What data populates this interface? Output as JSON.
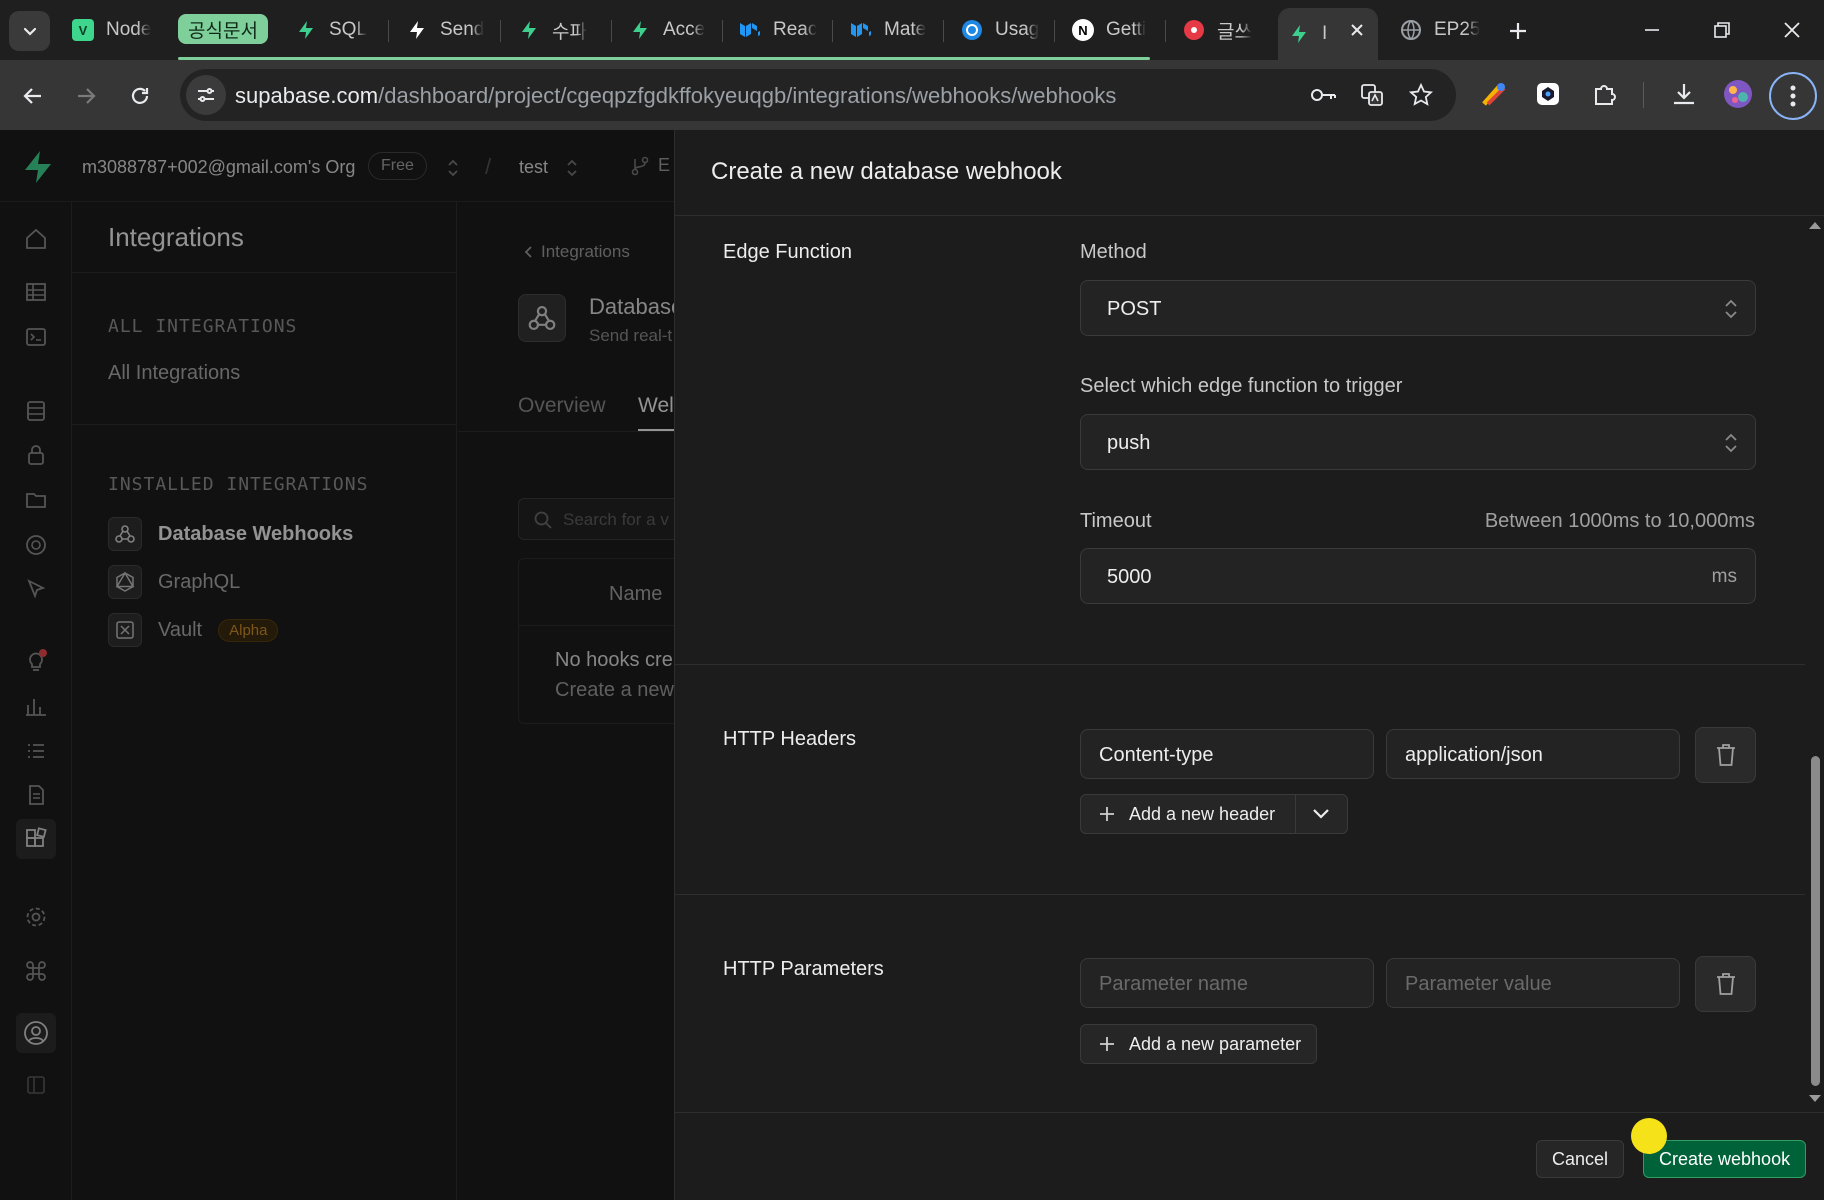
{
  "browser": {
    "tabs": [
      {
        "title": "Node",
        "icon": "v-icon",
        "color": "#3dd68c"
      },
      {
        "title": "SQL",
        "icon": "supabase-bolt-icon",
        "color": "#3ecf8e"
      },
      {
        "title": "Send",
        "icon": "bolt-icon",
        "color": "#ffffff"
      },
      {
        "title": "수파",
        "icon": "supabase-bolt-icon",
        "color": "#3ecf8e"
      },
      {
        "title": "Acce",
        "icon": "supabase-bolt-icon",
        "color": "#3ecf8e"
      },
      {
        "title": "Reac",
        "icon": "mui-icon",
        "color": "#2196f3"
      },
      {
        "title": "Mate",
        "icon": "mui-icon",
        "color": "#2196f3"
      },
      {
        "title": "Usag",
        "icon": "openai-icon",
        "color": "#1e88e5"
      },
      {
        "title": "Getti",
        "icon": "next-icon",
        "color": "#ffffff"
      },
      {
        "title": "글쓰",
        "icon": "red-circle-icon",
        "color": "#e53945"
      },
      {
        "title": "I",
        "icon": "supabase-bolt-icon",
        "color": "#3ecf8e"
      },
      {
        "title": "EP25",
        "icon": "globe-icon",
        "color": "#9aa0a6"
      }
    ],
    "tab_group_label": "공식문서",
    "url_host": "supabase.com",
    "url_path": "/dashboard/project/cgeqpzfgdkffokyeuqgb/integrations/webhooks/webhooks"
  },
  "app": {
    "org_name": "m3088787+002@gmail.com's Org",
    "plan": "Free",
    "project": "test",
    "branch_label": "E",
    "sidebar_title": "Integrations",
    "all_section": "ALL INTEGRATIONS",
    "all_link": "All Integrations",
    "installed_section": "INSTALLED INTEGRATIONS",
    "installed": [
      {
        "label": "Database Webhooks",
        "icon": "webhook-icon",
        "active": true
      },
      {
        "label": "GraphQL",
        "icon": "graphql-icon",
        "active": false
      },
      {
        "label": "Vault",
        "icon": "vault-icon",
        "active": false,
        "badge": "Alpha"
      }
    ],
    "breadcrumb": "Integrations",
    "integration_title": "Database",
    "integration_sub": "Send real-t",
    "tabs": [
      "Overview",
      "Wel"
    ],
    "search_placeholder": "Search for a v",
    "table_header": "Name",
    "empty_title": "No hooks cre",
    "empty_sub": "Create a new"
  },
  "sheet": {
    "title": "Create a new database webhook",
    "edge_section": "Edge Function",
    "method_label": "Method",
    "method_value": "POST",
    "function_label": "Select which edge function to trigger",
    "function_value": "push",
    "timeout_label": "Timeout",
    "timeout_hint": "Between 1000ms to 10,000ms",
    "timeout_value": "5000",
    "timeout_unit": "ms",
    "headers_section": "HTTP Headers",
    "header_name": "Content-type",
    "header_value": "application/json",
    "add_header": "Add a new header",
    "params_section": "HTTP Parameters",
    "param_name_placeholder": "Parameter name",
    "param_value_placeholder": "Parameter value",
    "add_param": "Add a new parameter",
    "cancel": "Cancel",
    "create": "Create webhook"
  },
  "colors": {
    "brand": "#3ecf8e",
    "create_button": "#006239",
    "cursor_highlight": "#f5e219"
  }
}
